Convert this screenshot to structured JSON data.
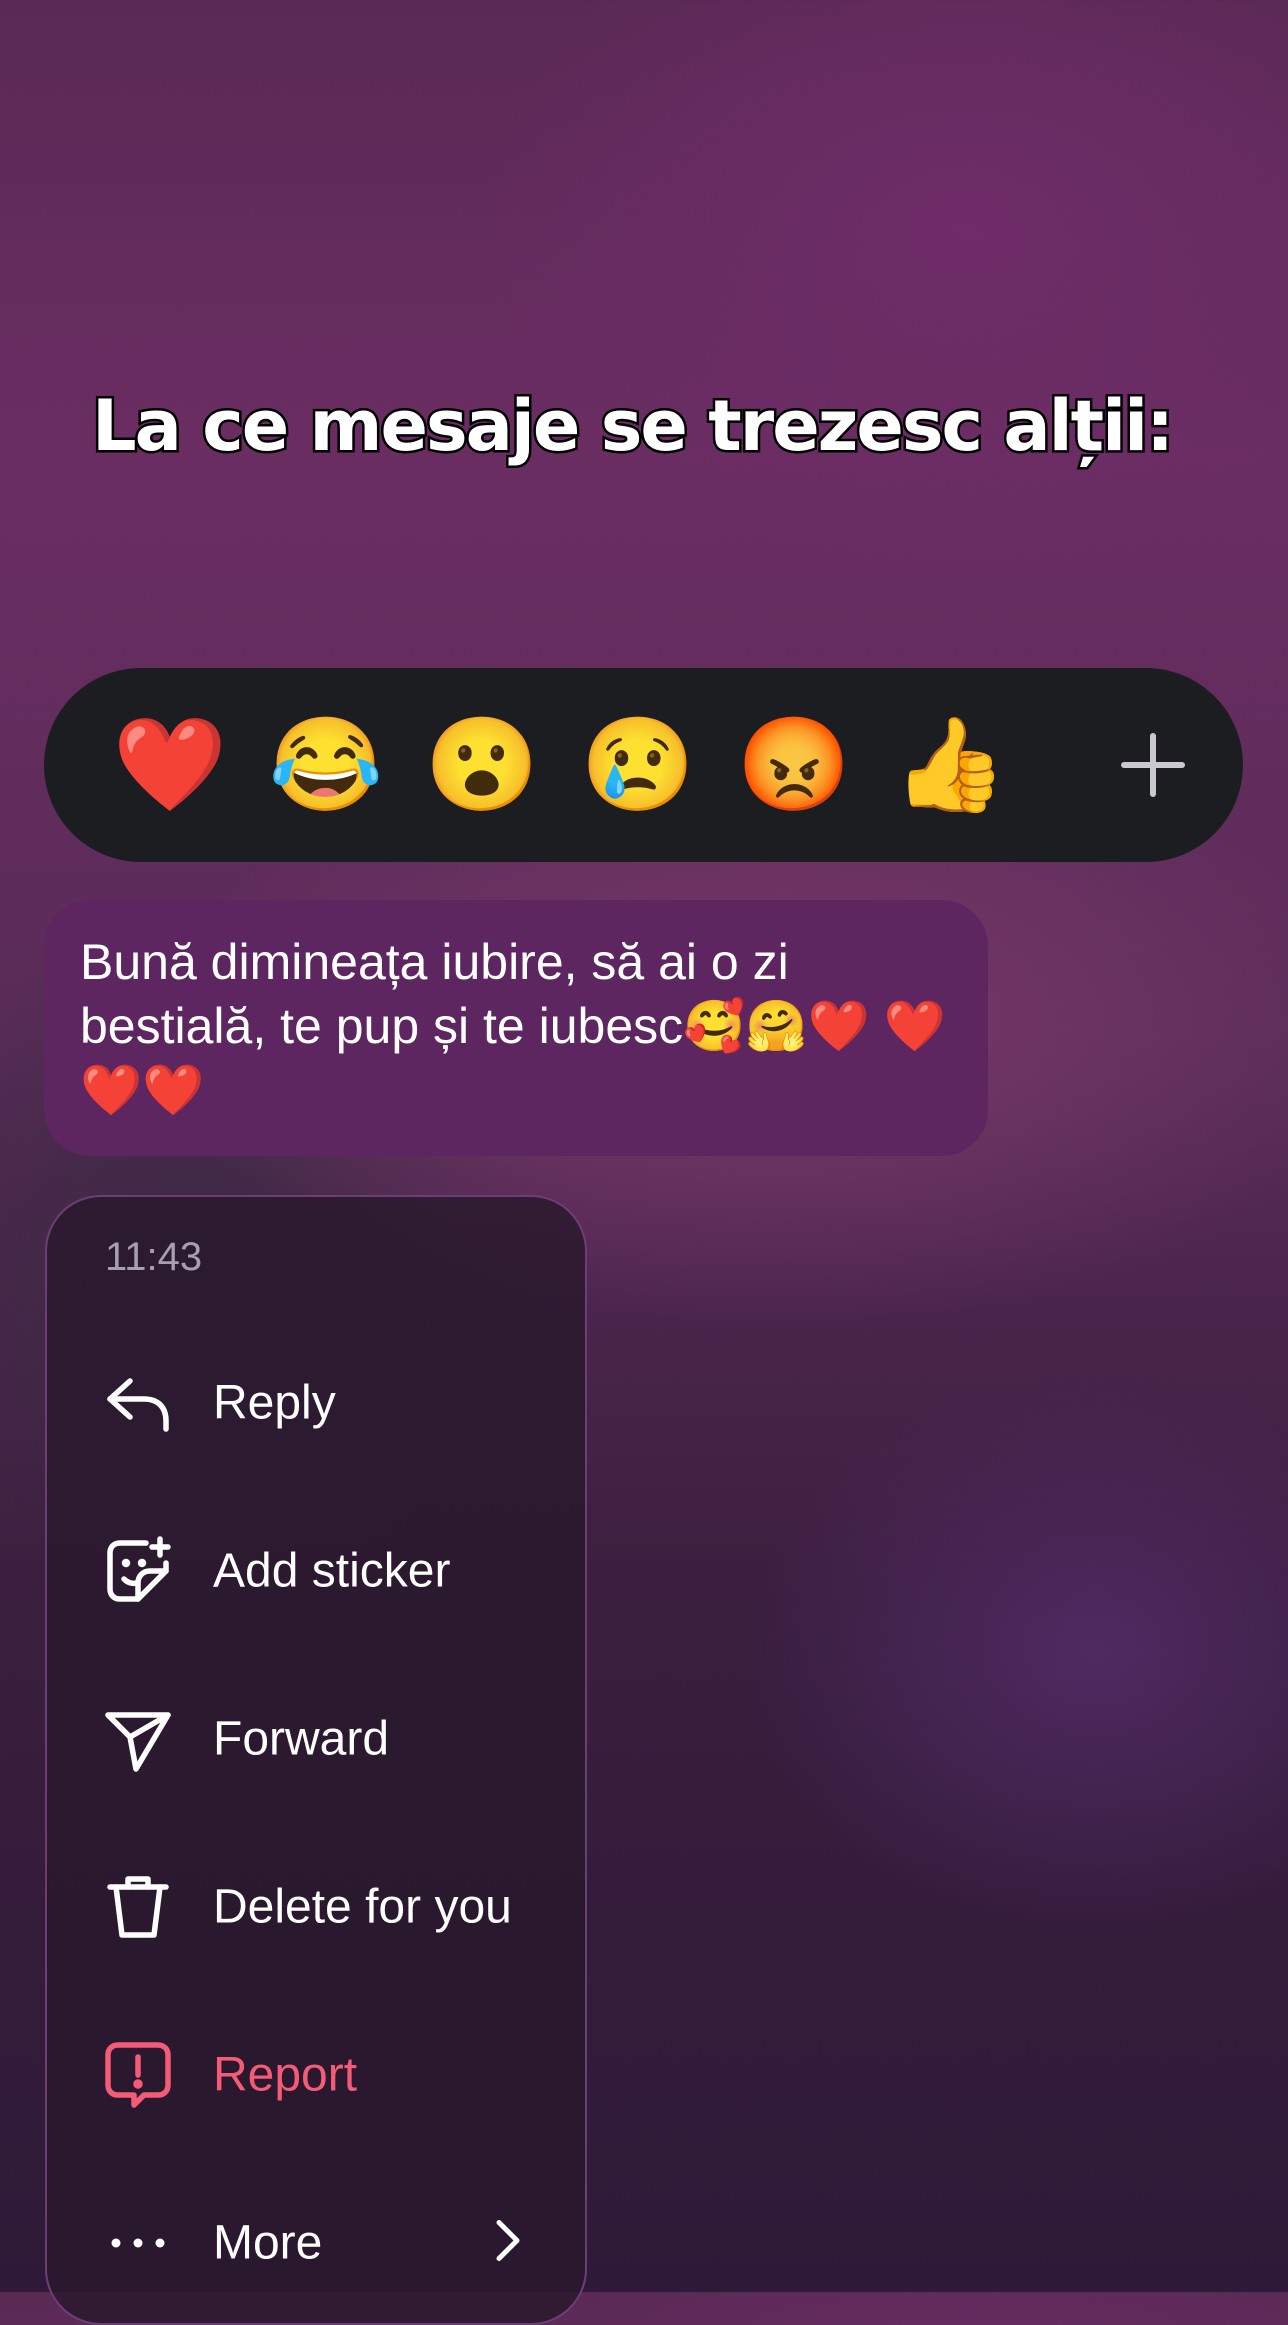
{
  "overlay": {
    "caption": "La ce mesaje se trezesc alții:"
  },
  "reactions": {
    "emojis": [
      "❤️",
      "😂",
      "😮",
      "😢",
      "😡",
      "👍"
    ],
    "more_icon": "plus-icon"
  },
  "message": {
    "text": "Bună dimineața iubire, să ai o zi bestială, te pup și te iubesc🥰🤗❤️ ❤️❤️❤️"
  },
  "context_menu": {
    "time": "11:43",
    "items": [
      {
        "label": "Reply",
        "icon": "reply-icon"
      },
      {
        "label": "Add sticker",
        "icon": "sticker-add-icon"
      },
      {
        "label": "Forward",
        "icon": "send-icon"
      },
      {
        "label": "Delete for you",
        "icon": "trash-icon"
      },
      {
        "label": "Report",
        "icon": "report-icon",
        "color": "#f35b77"
      },
      {
        "label": "More",
        "icon": "more-dots-icon"
      }
    ]
  },
  "colors": {
    "reaction_bar": "#1c1d21",
    "bubble": "#5e2660",
    "menu_border": "#6e3d78",
    "danger": "#f35b77"
  }
}
